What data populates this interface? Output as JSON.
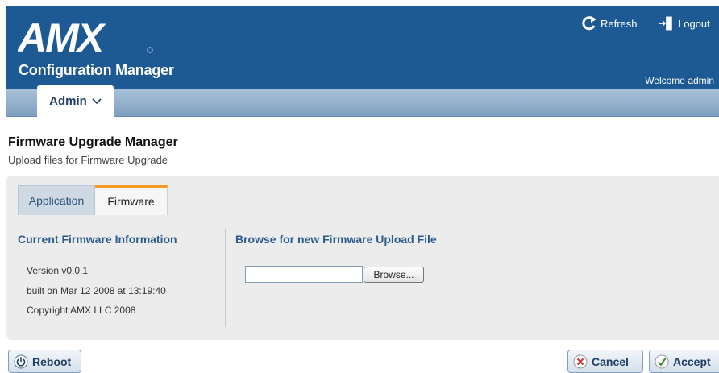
{
  "header": {
    "brand": "AMX",
    "app_title": "Configuration Manager",
    "refresh_label": "Refresh",
    "logout_label": "Logout",
    "welcome": "Welcome admin",
    "bg_color": "#1d5a93"
  },
  "nav": {
    "tab_label": "Admin",
    "tab_icon": "chevron-down-icon"
  },
  "page": {
    "title": "Firmware Upgrade Manager",
    "subtitle": "Upload files for Firmware Upgrade"
  },
  "tabs": [
    {
      "label": "Application",
      "active": false
    },
    {
      "label": "Firmware",
      "active": true
    }
  ],
  "current_info": {
    "title": "Current Firmware Information",
    "version": "Version v0.0.1",
    "built": "built on Mar 12 2008 at 13:19:40",
    "copyright": "Copyright AMX LLC 2008"
  },
  "upload": {
    "title": "Browse for new Firmware Upload File",
    "file_value": "",
    "browse_label": "Browse..."
  },
  "footer": {
    "reboot_label": "Reboot",
    "cancel_label": "Cancel",
    "accept_label": "Accept"
  },
  "colors": {
    "accent": "#2a5b8c",
    "tab_highlight": "#f29b20",
    "cancel_icon": "#d03030",
    "accept_icon": "#3a8a2a"
  }
}
